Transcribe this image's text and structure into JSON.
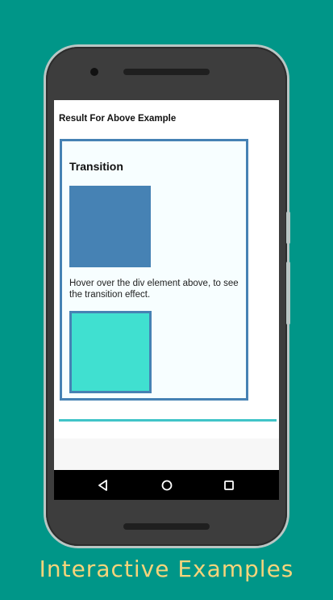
{
  "result_heading": "Result For Above Example",
  "demo": {
    "title": "Transition",
    "hint": "Hover over the div element above, to see the transition effect."
  },
  "colors": {
    "background": "#009688",
    "square_blue": "#4682b4",
    "square_teal": "#40e0d0",
    "caption": "#f6d47b"
  },
  "navbar": {
    "icons": [
      "back-icon",
      "home-icon",
      "recent-apps-icon"
    ]
  },
  "caption": "Interactive Examples"
}
